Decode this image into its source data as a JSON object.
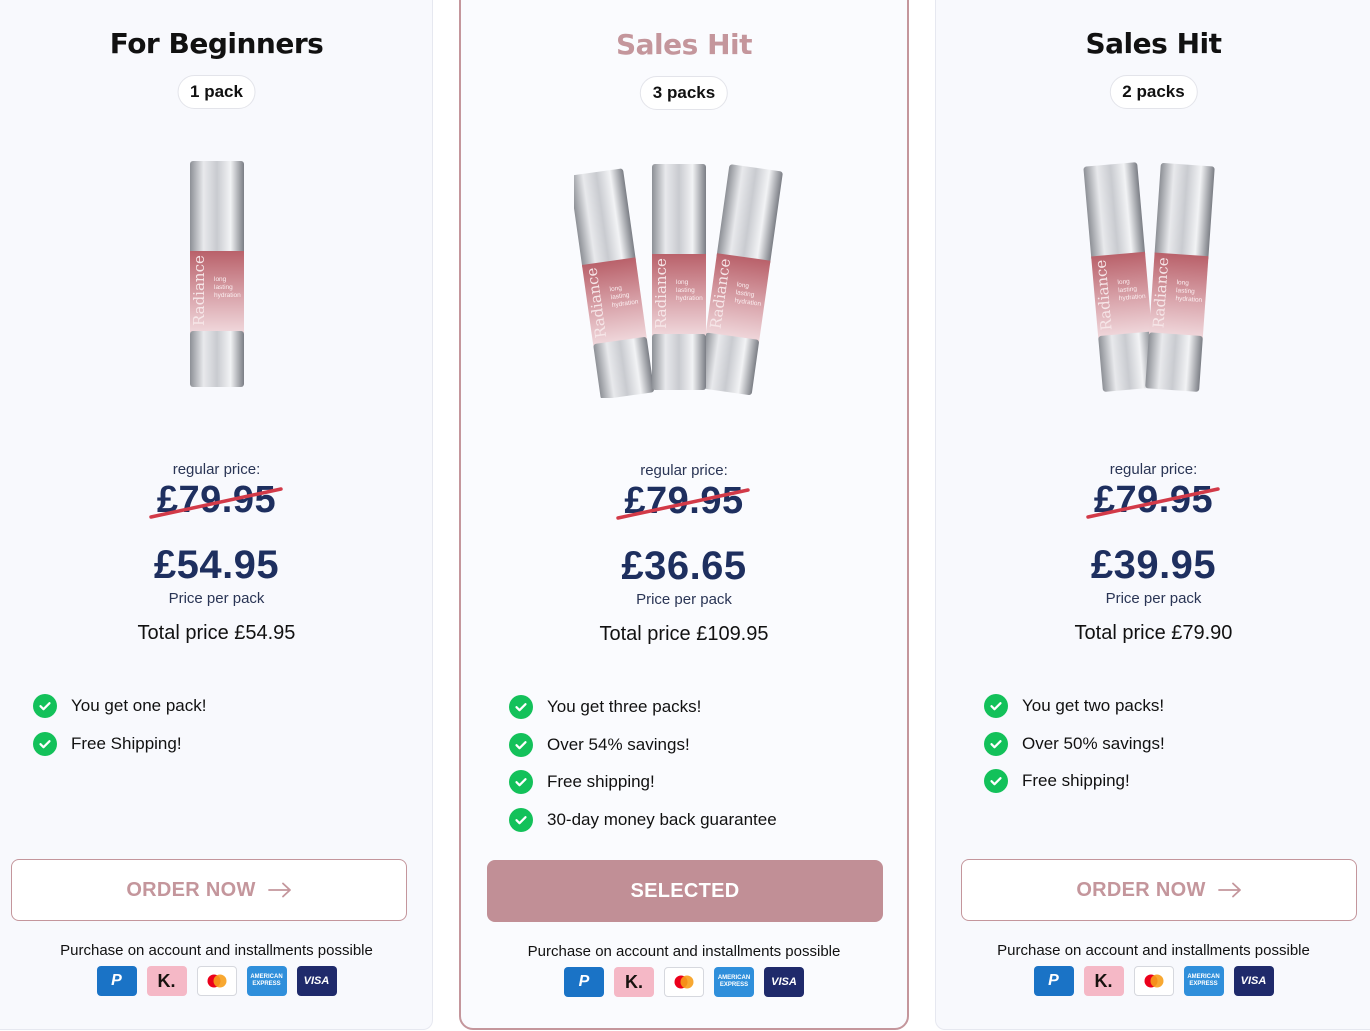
{
  "colors": {
    "accent": "#c4969c",
    "price_navy": "#1e2f5f",
    "check_green": "#13c15a",
    "strike_red": "#d23a48"
  },
  "common": {
    "regular_label": "regular price:",
    "old_price": "£79.95",
    "per_pack_label": "Price per pack",
    "installments": "Purchase on account and installments possible",
    "payment_icons": [
      "paypal-icon",
      "klarna-icon",
      "mastercard-icon",
      "amex-icon",
      "visa-icon"
    ],
    "paypal_glyph": "P",
    "klarna_glyph": "K.",
    "amex_line1": "AMERICAN",
    "amex_line2": "EXPRESS",
    "visa_glyph": "VISA"
  },
  "cards": [
    {
      "title": "For Beginners",
      "pack_label": "1 pack",
      "price": "£54.95",
      "total": "Total price £54.95",
      "features": [
        "You get one pack!",
        "Free Shipping!"
      ],
      "button": "ORDER NOW"
    },
    {
      "title": "Sales Hit",
      "pack_label": "3 packs",
      "price": "£36.65",
      "total": "Total price £109.95",
      "features": [
        "You get three packs!",
        "Over 54% savings!",
        "Free shipping!",
        "30-day money back guarantee"
      ],
      "button": "SELECTED",
      "selected": true
    },
    {
      "title": "Sales Hit",
      "pack_label": "2 packs",
      "price": "£39.95",
      "total": "Total price £79.90",
      "features": [
        "You get two packs!",
        "Over 50% savings!",
        "Free shipping!"
      ],
      "button": "ORDER NOW"
    }
  ],
  "bottle": {
    "brand": "Radiance",
    "line1": "long",
    "line2": "lasting",
    "line3": "hydration"
  }
}
